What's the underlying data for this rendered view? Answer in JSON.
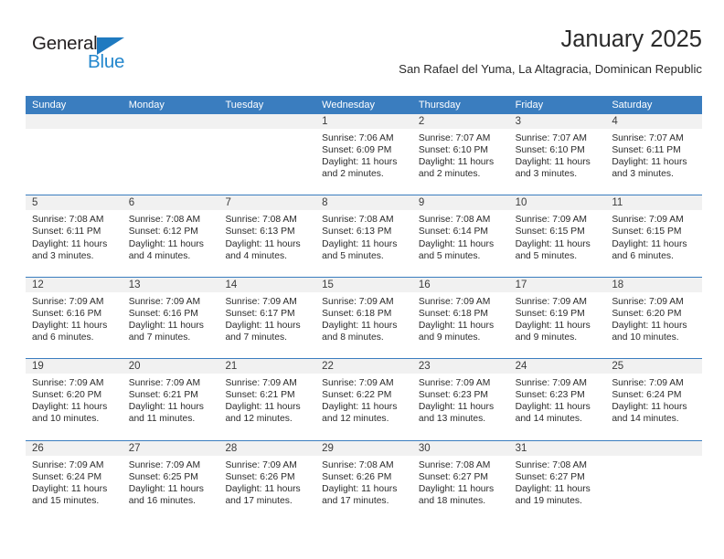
{
  "brand": {
    "name_top": "General",
    "name_bottom": "Blue",
    "color_dark": "#231f20",
    "color_blue": "#2387cd"
  },
  "header": {
    "title": "January 2025",
    "subtitle": "San Rafael del Yuma, La Altagracia, Dominican Republic"
  },
  "theme": {
    "header_blue": "#3a7dbf",
    "band_gray": "#f1f1f1",
    "text": "#2b2b2b"
  },
  "weekdays": [
    "Sunday",
    "Monday",
    "Tuesday",
    "Wednesday",
    "Thursday",
    "Friday",
    "Saturday"
  ],
  "weeks": [
    [
      {
        "day": "",
        "lines": []
      },
      {
        "day": "",
        "lines": []
      },
      {
        "day": "",
        "lines": []
      },
      {
        "day": "1",
        "lines": [
          "Sunrise: 7:06 AM",
          "Sunset: 6:09 PM",
          "Daylight: 11 hours",
          "and 2 minutes."
        ]
      },
      {
        "day": "2",
        "lines": [
          "Sunrise: 7:07 AM",
          "Sunset: 6:10 PM",
          "Daylight: 11 hours",
          "and 2 minutes."
        ]
      },
      {
        "day": "3",
        "lines": [
          "Sunrise: 7:07 AM",
          "Sunset: 6:10 PM",
          "Daylight: 11 hours",
          "and 3 minutes."
        ]
      },
      {
        "day": "4",
        "lines": [
          "Sunrise: 7:07 AM",
          "Sunset: 6:11 PM",
          "Daylight: 11 hours",
          "and 3 minutes."
        ]
      }
    ],
    [
      {
        "day": "5",
        "lines": [
          "Sunrise: 7:08 AM",
          "Sunset: 6:11 PM",
          "Daylight: 11 hours",
          "and 3 minutes."
        ]
      },
      {
        "day": "6",
        "lines": [
          "Sunrise: 7:08 AM",
          "Sunset: 6:12 PM",
          "Daylight: 11 hours",
          "and 4 minutes."
        ]
      },
      {
        "day": "7",
        "lines": [
          "Sunrise: 7:08 AM",
          "Sunset: 6:13 PM",
          "Daylight: 11 hours",
          "and 4 minutes."
        ]
      },
      {
        "day": "8",
        "lines": [
          "Sunrise: 7:08 AM",
          "Sunset: 6:13 PM",
          "Daylight: 11 hours",
          "and 5 minutes."
        ]
      },
      {
        "day": "9",
        "lines": [
          "Sunrise: 7:08 AM",
          "Sunset: 6:14 PM",
          "Daylight: 11 hours",
          "and 5 minutes."
        ]
      },
      {
        "day": "10",
        "lines": [
          "Sunrise: 7:09 AM",
          "Sunset: 6:15 PM",
          "Daylight: 11 hours",
          "and 5 minutes."
        ]
      },
      {
        "day": "11",
        "lines": [
          "Sunrise: 7:09 AM",
          "Sunset: 6:15 PM",
          "Daylight: 11 hours",
          "and 6 minutes."
        ]
      }
    ],
    [
      {
        "day": "12",
        "lines": [
          "Sunrise: 7:09 AM",
          "Sunset: 6:16 PM",
          "Daylight: 11 hours",
          "and 6 minutes."
        ]
      },
      {
        "day": "13",
        "lines": [
          "Sunrise: 7:09 AM",
          "Sunset: 6:16 PM",
          "Daylight: 11 hours",
          "and 7 minutes."
        ]
      },
      {
        "day": "14",
        "lines": [
          "Sunrise: 7:09 AM",
          "Sunset: 6:17 PM",
          "Daylight: 11 hours",
          "and 7 minutes."
        ]
      },
      {
        "day": "15",
        "lines": [
          "Sunrise: 7:09 AM",
          "Sunset: 6:18 PM",
          "Daylight: 11 hours",
          "and 8 minutes."
        ]
      },
      {
        "day": "16",
        "lines": [
          "Sunrise: 7:09 AM",
          "Sunset: 6:18 PM",
          "Daylight: 11 hours",
          "and 9 minutes."
        ]
      },
      {
        "day": "17",
        "lines": [
          "Sunrise: 7:09 AM",
          "Sunset: 6:19 PM",
          "Daylight: 11 hours",
          "and 9 minutes."
        ]
      },
      {
        "day": "18",
        "lines": [
          "Sunrise: 7:09 AM",
          "Sunset: 6:20 PM",
          "Daylight: 11 hours",
          "and 10 minutes."
        ]
      }
    ],
    [
      {
        "day": "19",
        "lines": [
          "Sunrise: 7:09 AM",
          "Sunset: 6:20 PM",
          "Daylight: 11 hours",
          "and 10 minutes."
        ]
      },
      {
        "day": "20",
        "lines": [
          "Sunrise: 7:09 AM",
          "Sunset: 6:21 PM",
          "Daylight: 11 hours",
          "and 11 minutes."
        ]
      },
      {
        "day": "21",
        "lines": [
          "Sunrise: 7:09 AM",
          "Sunset: 6:21 PM",
          "Daylight: 11 hours",
          "and 12 minutes."
        ]
      },
      {
        "day": "22",
        "lines": [
          "Sunrise: 7:09 AM",
          "Sunset: 6:22 PM",
          "Daylight: 11 hours",
          "and 12 minutes."
        ]
      },
      {
        "day": "23",
        "lines": [
          "Sunrise: 7:09 AM",
          "Sunset: 6:23 PM",
          "Daylight: 11 hours",
          "and 13 minutes."
        ]
      },
      {
        "day": "24",
        "lines": [
          "Sunrise: 7:09 AM",
          "Sunset: 6:23 PM",
          "Daylight: 11 hours",
          "and 14 minutes."
        ]
      },
      {
        "day": "25",
        "lines": [
          "Sunrise: 7:09 AM",
          "Sunset: 6:24 PM",
          "Daylight: 11 hours",
          "and 14 minutes."
        ]
      }
    ],
    [
      {
        "day": "26",
        "lines": [
          "Sunrise: 7:09 AM",
          "Sunset: 6:24 PM",
          "Daylight: 11 hours",
          "and 15 minutes."
        ]
      },
      {
        "day": "27",
        "lines": [
          "Sunrise: 7:09 AM",
          "Sunset: 6:25 PM",
          "Daylight: 11 hours",
          "and 16 minutes."
        ]
      },
      {
        "day": "28",
        "lines": [
          "Sunrise: 7:09 AM",
          "Sunset: 6:26 PM",
          "Daylight: 11 hours",
          "and 17 minutes."
        ]
      },
      {
        "day": "29",
        "lines": [
          "Sunrise: 7:08 AM",
          "Sunset: 6:26 PM",
          "Daylight: 11 hours",
          "and 17 minutes."
        ]
      },
      {
        "day": "30",
        "lines": [
          "Sunrise: 7:08 AM",
          "Sunset: 6:27 PM",
          "Daylight: 11 hours",
          "and 18 minutes."
        ]
      },
      {
        "day": "31",
        "lines": [
          "Sunrise: 7:08 AM",
          "Sunset: 6:27 PM",
          "Daylight: 11 hours",
          "and 19 minutes."
        ]
      },
      {
        "day": "",
        "lines": []
      }
    ]
  ]
}
